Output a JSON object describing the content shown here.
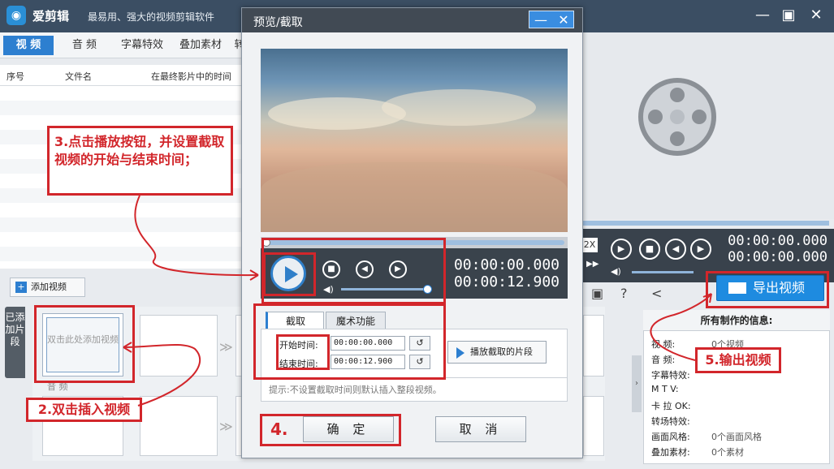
{
  "app": {
    "name": "爱剪辑",
    "slogan": "最易用、强大的视频剪辑软件",
    "tabs": [
      "视 频",
      "音 频",
      "字幕特效",
      "叠加素材",
      "转"
    ],
    "columns": [
      "序号",
      "文件名",
      "在最终影片中的时间"
    ],
    "add_video": "添加视频",
    "side_tab": "已添加片段",
    "first_clip": "双击此处添加视频",
    "audio_label": "音 频",
    "export_label": "导出视频",
    "right_time_top": "00:00:00.000",
    "right_time_bottom": "00:00:00.000",
    "speed_label": "2X",
    "colors": {
      "titlebar": "#3b4e63",
      "accent": "#2d7fd0",
      "annotation": "#d2262b"
    }
  },
  "info_panel": {
    "title": "所有制作的信息:",
    "rows": [
      {
        "label": "视    频:",
        "value": "0个视频"
      },
      {
        "label": "音    频:",
        "value": ""
      },
      {
        "label": "字幕特效:",
        "value": ""
      },
      {
        "label": "M  T  V:",
        "value": ""
      },
      {
        "label": "卡 拉 OK:",
        "value": ""
      },
      {
        "label": "转场特效:",
        "value": ""
      },
      {
        "label": "画面风格:",
        "value": "0个画面风格"
      },
      {
        "label": "叠加素材:",
        "value": "0个素材"
      }
    ]
  },
  "dialog": {
    "title": "预览/截取",
    "time_current": "00:00:00.000",
    "time_total": "00:00:12.900",
    "tabs": [
      "截取",
      "魔术功能"
    ],
    "start_label": "开始时间:",
    "start_value": "00:00:00.000",
    "end_label": "结束时间:",
    "end_value": "00:00:12.900",
    "play_clip": "播放截取的片段",
    "hint": "提示:不设置截取时间则默认插入整段视频。",
    "ok": "确 定",
    "cancel": "取 消"
  },
  "annotations": {
    "step3": "3.点击播放按钮，并设置截取视频的开始与结束时间；",
    "step2": "2.双击插入视频",
    "step4": "4.",
    "step5": "5.输出视频"
  }
}
